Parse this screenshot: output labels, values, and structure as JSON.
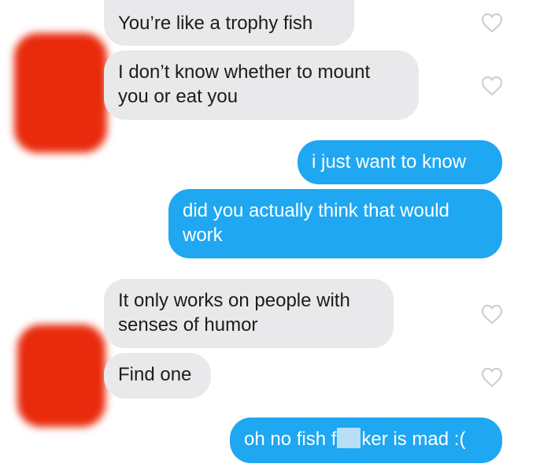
{
  "conversation": {
    "messages": [
      {
        "sender": "them",
        "text": "You’re like a trophy fish",
        "liked": false
      },
      {
        "sender": "them",
        "text": "I don’t know whether to mount\nyou or eat you",
        "liked": false
      },
      {
        "sender": "me",
        "text": "i just want to know"
      },
      {
        "sender": "me",
        "text": "did you actually think that would\nwork"
      },
      {
        "sender": "them",
        "text": "It only works on people with\nsenses of humor",
        "liked": false
      },
      {
        "sender": "them",
        "text": "Find one",
        "liked": false
      },
      {
        "sender": "me",
        "text_before": "oh no fish f",
        "text_after": "ker is mad :("
      }
    ]
  },
  "icons": {
    "like": "heart-outline-icon"
  },
  "colors": {
    "incoming_bubble": "#e9e9eb",
    "outgoing_bubble": "#1fa7f2",
    "incoming_text": "#1c1c1c",
    "outgoing_text": "#ffffff",
    "redaction": "#e92a0c",
    "heart_outline": "#cfcfd3"
  }
}
